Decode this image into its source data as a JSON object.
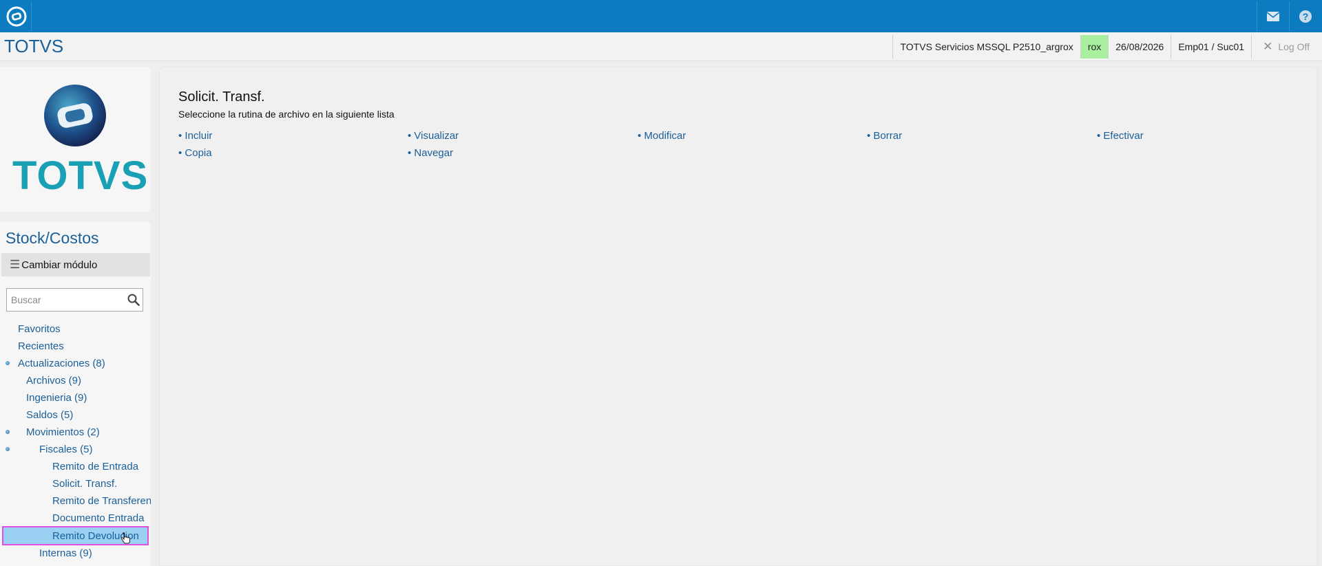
{
  "topbar": {
    "logo_icon": "totvs-logo-icon",
    "mail_icon": "mail-icon",
    "help_icon": "help-icon"
  },
  "header": {
    "brand": "TOTVS",
    "environment": "TOTVS Servicios MSSQL P2510_argrox",
    "user": "rox",
    "date": "26/08/2026",
    "company_branch": "Emp01 / Suc01",
    "logoff_label": "Log Off"
  },
  "sidebar": {
    "logo_text": "TOTVS",
    "module_title": "Stock/Costos",
    "change_module_label": "Cambiar módulo",
    "search_placeholder": "Buscar",
    "tree": [
      {
        "label": "Favoritos",
        "level": 0,
        "dot": false
      },
      {
        "label": "Recientes",
        "level": 0,
        "dot": false
      },
      {
        "label": "Actualizaciones (8)",
        "level": 0,
        "dot": true
      },
      {
        "label": "Archivos (9)",
        "level": 1,
        "dot": false
      },
      {
        "label": "Ingenieria (9)",
        "level": 1,
        "dot": false
      },
      {
        "label": "Saldos (5)",
        "level": 1,
        "dot": false
      },
      {
        "label": "Movimientos (2)",
        "level": 1,
        "dot": true
      },
      {
        "label": "Fiscales (5)",
        "level": 2,
        "dot": true
      },
      {
        "label": "Remito de Entrada",
        "level": 3,
        "dot": false
      },
      {
        "label": "Solicit. Transf.",
        "level": 3,
        "dot": false
      },
      {
        "label": "Remito de Transferen",
        "level": 3,
        "dot": false
      },
      {
        "label": "Documento Entrada",
        "level": 3,
        "dot": false
      },
      {
        "label": "Remito Devolucion",
        "level": 3,
        "dot": false,
        "selected": true
      },
      {
        "label": "Internas (9)",
        "level": 2,
        "dot": false
      }
    ]
  },
  "main": {
    "title": "Solicit. Transf.",
    "subtitle": "Seleccione la rutina de archivo en la siguiente lista",
    "actions": [
      "• Incluir",
      "• Visualizar",
      "• Modificar",
      "• Borrar",
      "• Efectivar",
      "• Copia",
      "• Navegar"
    ]
  },
  "colors": {
    "topbar": "#0c7bbf",
    "link": "#1b5f99",
    "user_highlight": "#a8f0a0",
    "selected_item": "#9ad0f2",
    "selected_outline": "#e14ee5"
  }
}
